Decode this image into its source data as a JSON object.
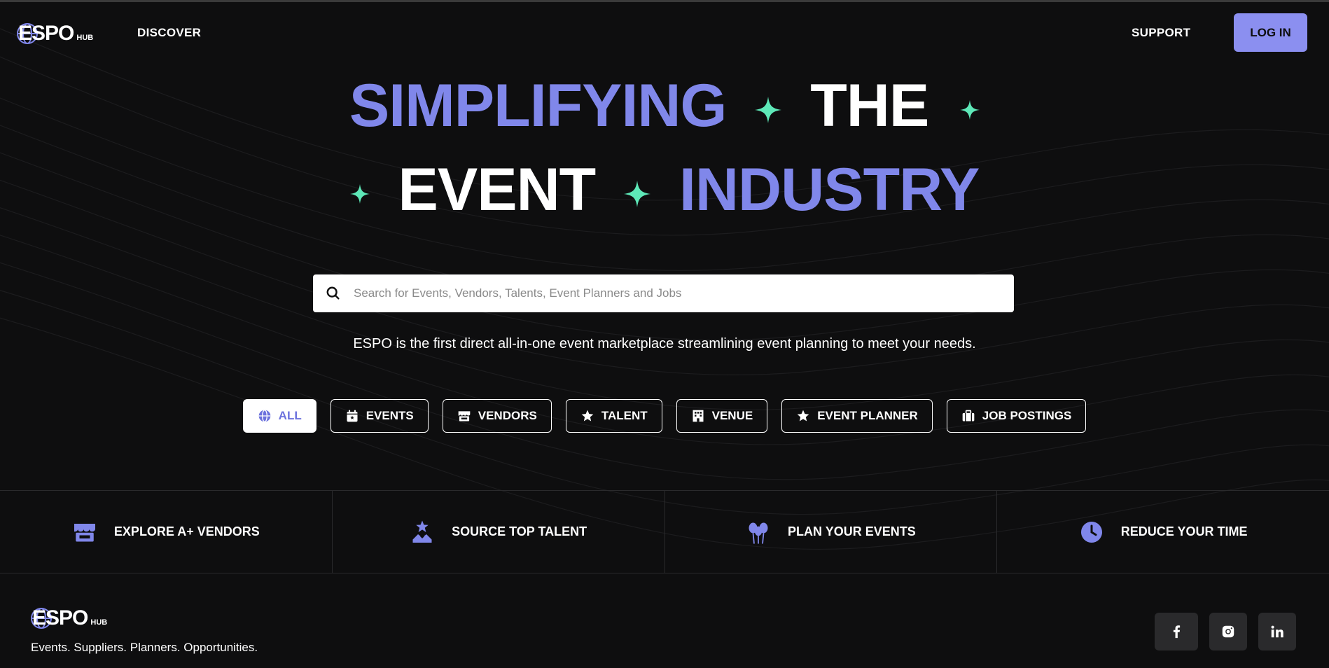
{
  "header": {
    "logo_text": "ESPO",
    "logo_sub": "HUB",
    "nav_discover": "DISCOVER",
    "nav_support": "SUPPORT",
    "login_label": "LOG IN"
  },
  "hero": {
    "line1_word1": "SIMPLIFYING",
    "line1_word2": "THE",
    "line2_word1": "EVENT",
    "line2_word2": "INDUSTRY"
  },
  "search": {
    "placeholder": "Search for Events, Vendors, Talents, Event Planners and Jobs"
  },
  "tagline": "ESPO is the first direct all-in-one event marketplace streamlining event planning to meet your needs.",
  "filters": [
    {
      "label": "ALL",
      "icon": "globe-icon",
      "active": true
    },
    {
      "label": "EVENTS",
      "icon": "calendar-icon",
      "active": false
    },
    {
      "label": "VENDORS",
      "icon": "store-icon",
      "active": false
    },
    {
      "label": "TALENT",
      "icon": "star-icon",
      "active": false
    },
    {
      "label": "VENUE",
      "icon": "building-icon",
      "active": false
    },
    {
      "label": "EVENT PLANNER",
      "icon": "star-icon",
      "active": false
    },
    {
      "label": "JOB POSTINGS",
      "icon": "briefcase-icon",
      "active": false
    }
  ],
  "features": [
    {
      "label": "EXPLORE A+ VENDORS",
      "icon": "store-icon"
    },
    {
      "label": "SOURCE TOP TALENT",
      "icon": "talent-star-icon"
    },
    {
      "label": "PLAN YOUR EVENTS",
      "icon": "balloons-icon"
    },
    {
      "label": "REDUCE YOUR TIME",
      "icon": "clock-icon"
    }
  ],
  "footer": {
    "logo_text": "ESPO",
    "logo_sub": "HUB",
    "tagline": "Events. Suppliers. Planners. Opportunities.",
    "social": [
      "facebook-icon",
      "instagram-icon",
      "linkedin-icon"
    ]
  },
  "colors": {
    "background": "#0e0e0f",
    "accent": "#8087ea",
    "button": "#8b8ff0",
    "sparkle": "#5ee8b8"
  }
}
